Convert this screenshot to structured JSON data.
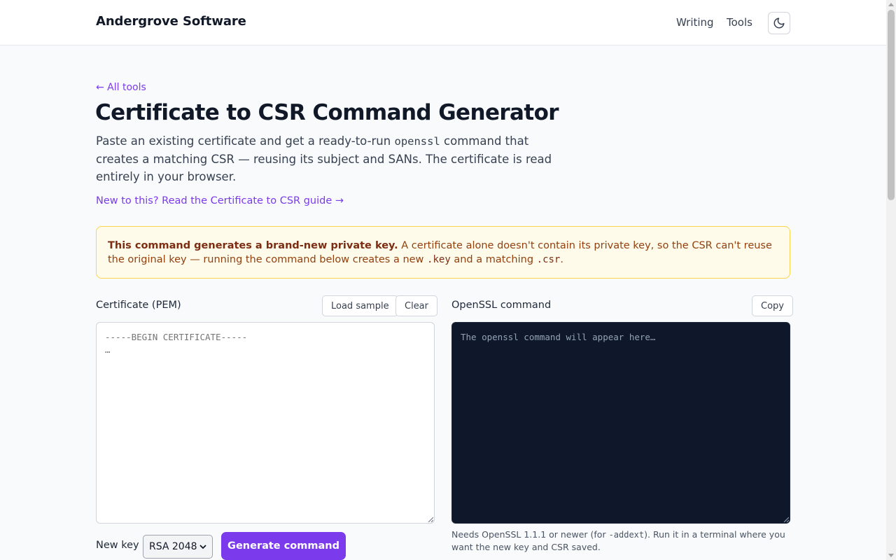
{
  "header": {
    "brand": "Andergrove Software",
    "nav": [
      {
        "label": "Writing"
      },
      {
        "label": "Tools"
      }
    ],
    "theme_toggle_icon": "moon-icon"
  },
  "content": {
    "back_link": "← All tools",
    "title": "Certificate to CSR Command Generator",
    "intro": {
      "part1": "Paste an existing certificate and get a ready-to-run ",
      "code": "openssl",
      "part2": " command that creates a matching CSR — reusing its subject and SANs. The certificate is read entirely in your browser."
    },
    "guide_link": "New to this? Read the Certificate to CSR guide →",
    "notice": {
      "bold": "This command generates a brand-new private key.",
      "part1": " A certificate alone doesn't contain its private key, so the CSR can't reuse the original key — running the command below creates a new ",
      "code1": ".key",
      "part2": " and a matching ",
      "code2": ".csr",
      "part3": "."
    }
  },
  "certificate_panel": {
    "label": "Certificate (PEM)",
    "load_sample": "Load sample",
    "clear": "Clear",
    "placeholder": "-----BEGIN CERTIFICATE-----\n…"
  },
  "output_panel": {
    "label": "OpenSSL command",
    "copy": "Copy",
    "placeholder": "The openssl command will appear here…",
    "help": {
      "part1": "Needs OpenSSL 1.1.1 or newer (for ",
      "code": "-addext",
      "part2": "). Run it in a terminal where you want the new key and CSR saved."
    }
  },
  "controls": {
    "new_key_label": "New key",
    "key_type": "RSA 2048",
    "generate": "Generate command"
  },
  "colors": {
    "accent": "#7c3aed",
    "notice_bg": "#fffbeb",
    "notice_border": "#fcd34d",
    "output_bg": "#0f172a"
  }
}
